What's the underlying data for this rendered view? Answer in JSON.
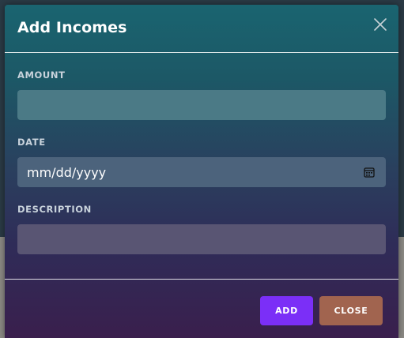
{
  "modal": {
    "title": "Add Incomes",
    "close_icon": "close-icon"
  },
  "form": {
    "amount": {
      "label": "AMOUNT",
      "value": "",
      "placeholder": ""
    },
    "date": {
      "label": "DATE",
      "value": "mm/dd/yyyy",
      "icon": "calendar-icon"
    },
    "description": {
      "label": "DESCRIPTION",
      "value": "",
      "placeholder": ""
    }
  },
  "footer": {
    "add_label": "ADD",
    "close_label": "CLOSE"
  },
  "colors": {
    "add_button": "#7b2ff7",
    "close_button": "#a1644f"
  }
}
